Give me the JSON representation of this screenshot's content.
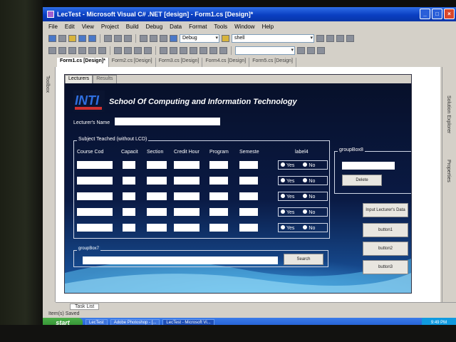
{
  "window": {
    "title": "LecTest - Microsoft Visual C# .NET [design] - Form1.cs [Design]*"
  },
  "menu": [
    "File",
    "Edit",
    "View",
    "Project",
    "Build",
    "Debug",
    "Data",
    "Format",
    "Tools",
    "Window",
    "Help"
  ],
  "toolbar": {
    "config_combo": "Debug",
    "project_combo": "shell"
  },
  "doc_tabs": [
    "Form1.cs [Design]*",
    "Form2.cs [Design]",
    "Form3.cs [Design]",
    "Form4.cs [Design]",
    "Form5.cs [Design]"
  ],
  "side": {
    "toolbox": "Toolbox",
    "solution_explorer": "Solution Explorer",
    "properties": "Properties"
  },
  "form": {
    "tabs": [
      "Lecturers",
      "Results"
    ],
    "logo_text": "INTI",
    "school_title": "School Of Computing and Information Technology",
    "lecturer_name_label": "Lecturer's Name",
    "subject_group_label": "Subject Teached (without LCD)",
    "columns": [
      "Course Cod",
      "Capacit",
      "Section",
      "Credit Hour",
      "Program",
      "Semeste"
    ],
    "label4": "label4",
    "radio_yes": "Yes",
    "radio_no": "No",
    "group8_label": "groupBox8",
    "delete_button": "Delete",
    "input_lecturer_button": "Input Lecturer's Data",
    "button1": "button1",
    "button2": "button2",
    "button3": "button3",
    "group7_label": "groupBox7",
    "search_button": "Search"
  },
  "bottom": {
    "task_list": "Task List",
    "status": "Item(s) Saved"
  },
  "taskbar": {
    "start": "start",
    "tasks": [
      "LecTest",
      "Adobe Photoshop - [...",
      "LecTest - Microsoft Vi..."
    ],
    "clock": "9:49 PM"
  },
  "colors": {
    "titlebar": "#0a3fc2",
    "form_bg": "#0a1430",
    "form_accent": "#1a5aa8",
    "taskbar": "#1f5bd0",
    "start": "#2e8c2e"
  }
}
